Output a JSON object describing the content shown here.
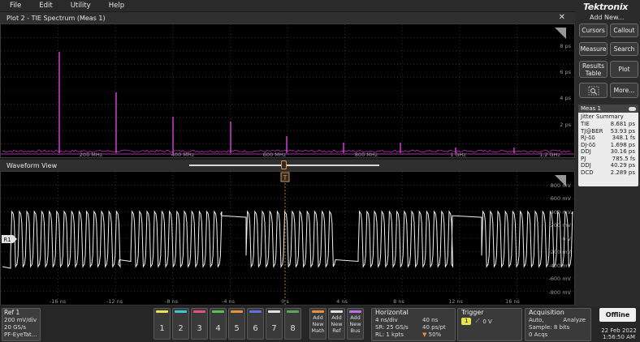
{
  "menu": [
    "File",
    "Edit",
    "Utility",
    "Help"
  ],
  "brand": "Tektronix",
  "right_panel": {
    "add_new": "Add New...",
    "buttons": [
      "Cursors",
      "Callout",
      "Measure",
      "Search",
      "Results Table",
      "Plot",
      "More..."
    ]
  },
  "measurement": {
    "title": "Meas 1",
    "summary": "Jitter Summary",
    "rows": [
      {
        "label": "TIE",
        "value": "8.681 ps"
      },
      {
        "label": "TJ@BER",
        "value": "53.93 ps"
      },
      {
        "label": "RJ-δδ",
        "value": "348.1 fs"
      },
      {
        "label": "DJ-δδ",
        "value": "1.698 ps"
      },
      {
        "label": "DDJ",
        "value": "30.16 ps"
      },
      {
        "label": "PJ",
        "value": "785.5 fs"
      },
      {
        "label": "DDJ",
        "value": "40.29 ps"
      },
      {
        "label": "DCD",
        "value": "2.289 ps"
      }
    ]
  },
  "spectrum": {
    "title": "Plot 2 - TIE Spectrum (Meas 1)",
    "y_ticks": [
      "8 ps",
      "6 ps",
      "4 ps",
      "2 ps"
    ],
    "x_ticks": [
      "200 MHz",
      "400 MHz",
      "600 MHz",
      "800 MHz",
      "1 GHz",
      "1.2 GHz"
    ],
    "color": "#e040e0"
  },
  "waveform": {
    "title": "Waveform View",
    "channel_label": "R1",
    "trigger_marker": "T",
    "y_ticks": [
      "800 mV",
      "600 mV",
      "400 mV",
      "200 mV",
      "0 V",
      "-200 mV",
      "-400 mV",
      "-600 mV",
      "-800 mV"
    ],
    "x_ticks": [
      "-16 ns",
      "-12 ns",
      "-8 ns",
      "-4 ns",
      "0 s",
      "4 ns",
      "8 ns",
      "12 ns",
      "16 ns"
    ],
    "color": "#f2f2f2"
  },
  "bottom": {
    "ref": {
      "title": "Ref 1",
      "lines": [
        "200 mV/div",
        "20 GS/s",
        "PF-EyeTat..."
      ]
    },
    "channels": [
      "1",
      "2",
      "3",
      "4",
      "5",
      "6",
      "7",
      "8"
    ],
    "channel_colors": [
      "#e9e24f",
      "#38c8d0",
      "#e8507a",
      "#58c050",
      "#e8903a",
      "#6070e0",
      "#e0e0e0",
      "#58a858"
    ],
    "add_new": [
      {
        "label": "Add New Math",
        "color": "#e8903a"
      },
      {
        "label": "Add New Ref",
        "color": "#e0e0e0"
      },
      {
        "label": "Add New Bus",
        "color": "#c070e0"
      }
    ],
    "horizontal": {
      "title": "Horizontal",
      "rows": [
        [
          "4 ns/div",
          "40 ns"
        ],
        [
          "SR: 25 GS/s",
          "40 ps/pt"
        ],
        [
          "RL: 1 kpts",
          "50%"
        ]
      ]
    },
    "trigger": {
      "title": "Trigger",
      "channel": "1",
      "level": "0 V"
    },
    "acquisition": {
      "title": "Acquisition",
      "rows": [
        [
          "Auto,",
          "Analyze"
        ],
        [
          "Sample: 8 bits",
          ""
        ],
        [
          "0 Acqs",
          ""
        ]
      ]
    },
    "status": "Offline",
    "date": "22 Feb 2022",
    "time": "1:56:50 AM"
  }
}
